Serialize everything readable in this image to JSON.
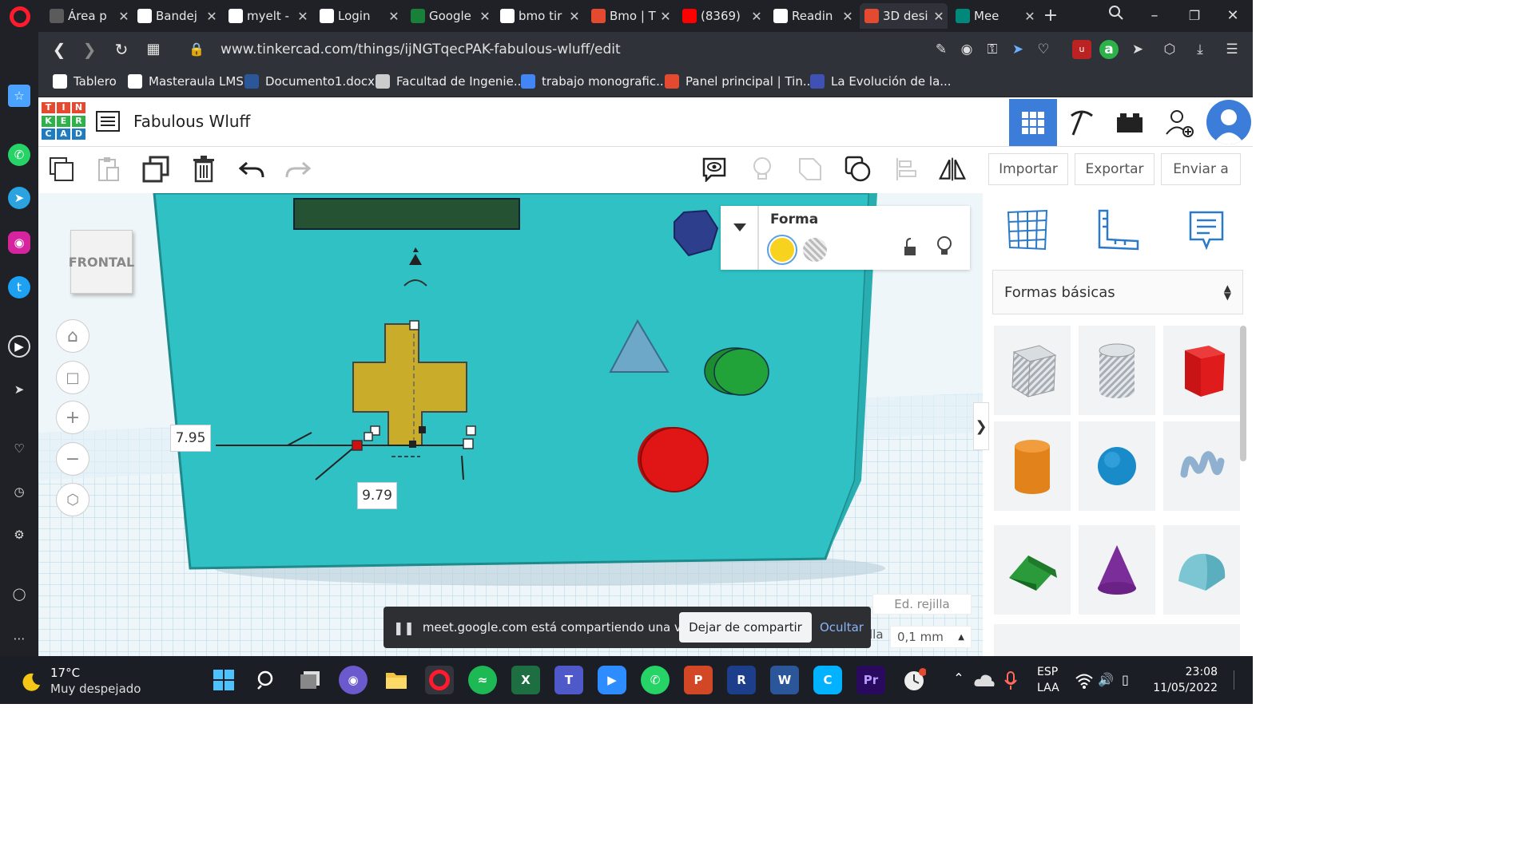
{
  "browser": {
    "tabs": [
      {
        "label": "Área p",
        "fav_color": "#5b5b5b"
      },
      {
        "label": "Bandej",
        "fav_color": "#ffffff"
      },
      {
        "label": "myelt -",
        "fav_color": "#ffffff"
      },
      {
        "label": "Login",
        "fav_color": "#ffffff"
      },
      {
        "label": "Google",
        "fav_color": "#188038"
      },
      {
        "label": "bmo tir",
        "fav_color": "#ffffff"
      },
      {
        "label": "Bmo | T",
        "fav_color": "#e34a2f"
      },
      {
        "label": "(8369)",
        "fav_color": "#ff0000"
      },
      {
        "label": "Readin",
        "fav_color": "#ffffff"
      },
      {
        "label": "3D desi",
        "fav_color": "#e34a2f",
        "active": true
      },
      {
        "label": "Mee",
        "fav_color": "#00897b"
      }
    ],
    "url": "www.tinkercad.com/things/ijNGTqecPAK-fabulous-wluff/edit",
    "bookmarks": [
      {
        "label": "Tablero",
        "color": "#ffffff"
      },
      {
        "label": "Masteraula LMS",
        "color": "#ffffff"
      },
      {
        "label": "Documento1.docx",
        "color": "#2b579a"
      },
      {
        "label": "Facultad de Ingenie...",
        "color": "#cccccc"
      },
      {
        "label": "trabajo monografic...",
        "color": "#4285f4"
      },
      {
        "label": "Panel principal | Tin...",
        "color": "#e34a2f"
      },
      {
        "label": "La Evolución de la...",
        "color": "#3f51b5"
      }
    ]
  },
  "app": {
    "logo": [
      "T",
      "I",
      "N",
      "K",
      "E",
      "R",
      "C",
      "A",
      "D"
    ],
    "logo_colors": [
      "#e34a2f",
      "#e34a2f",
      "#e34a2f",
      "#2db24a",
      "#2db24a",
      "#2db24a",
      "#1f7cc1",
      "#1f7cc1",
      "#1f7cc1"
    ],
    "title": "Fabulous Wluff",
    "toolbar": {
      "import_label": "Importar",
      "export_label": "Exportar",
      "send_label": "Enviar a"
    },
    "view_cube_label": "FRONTAL",
    "dimensions": {
      "width_value": "7.95",
      "depth_value": "9.79"
    },
    "shape_panel": {
      "title": "Forma"
    },
    "library": {
      "category": "Formas básicas"
    },
    "grid": {
      "edit_label": "Ed. rejilla",
      "snap_partial": "lla",
      "snap_value": "0,1 mm"
    },
    "share_bar": {
      "message": "meet.google.com está compartiendo una ventana.",
      "stop_label": "Dejar de compartir",
      "hide_label": "Ocultar"
    }
  },
  "taskbar": {
    "temperature": "17°C",
    "weather": "Muy despejado",
    "lang1": "ESP",
    "lang2": "LAA",
    "time": "23:08",
    "date": "11/05/2022"
  },
  "colors": {
    "accent": "#3b7dd8",
    "box": "#2fc1c4",
    "plus_shape": "#c8ac2a",
    "triangle": "#6ea8c8",
    "green_cyl": "#22a33a",
    "red_cyl": "#e01515",
    "hex_cyl": "#2c3e8c",
    "screen": "#245232"
  }
}
